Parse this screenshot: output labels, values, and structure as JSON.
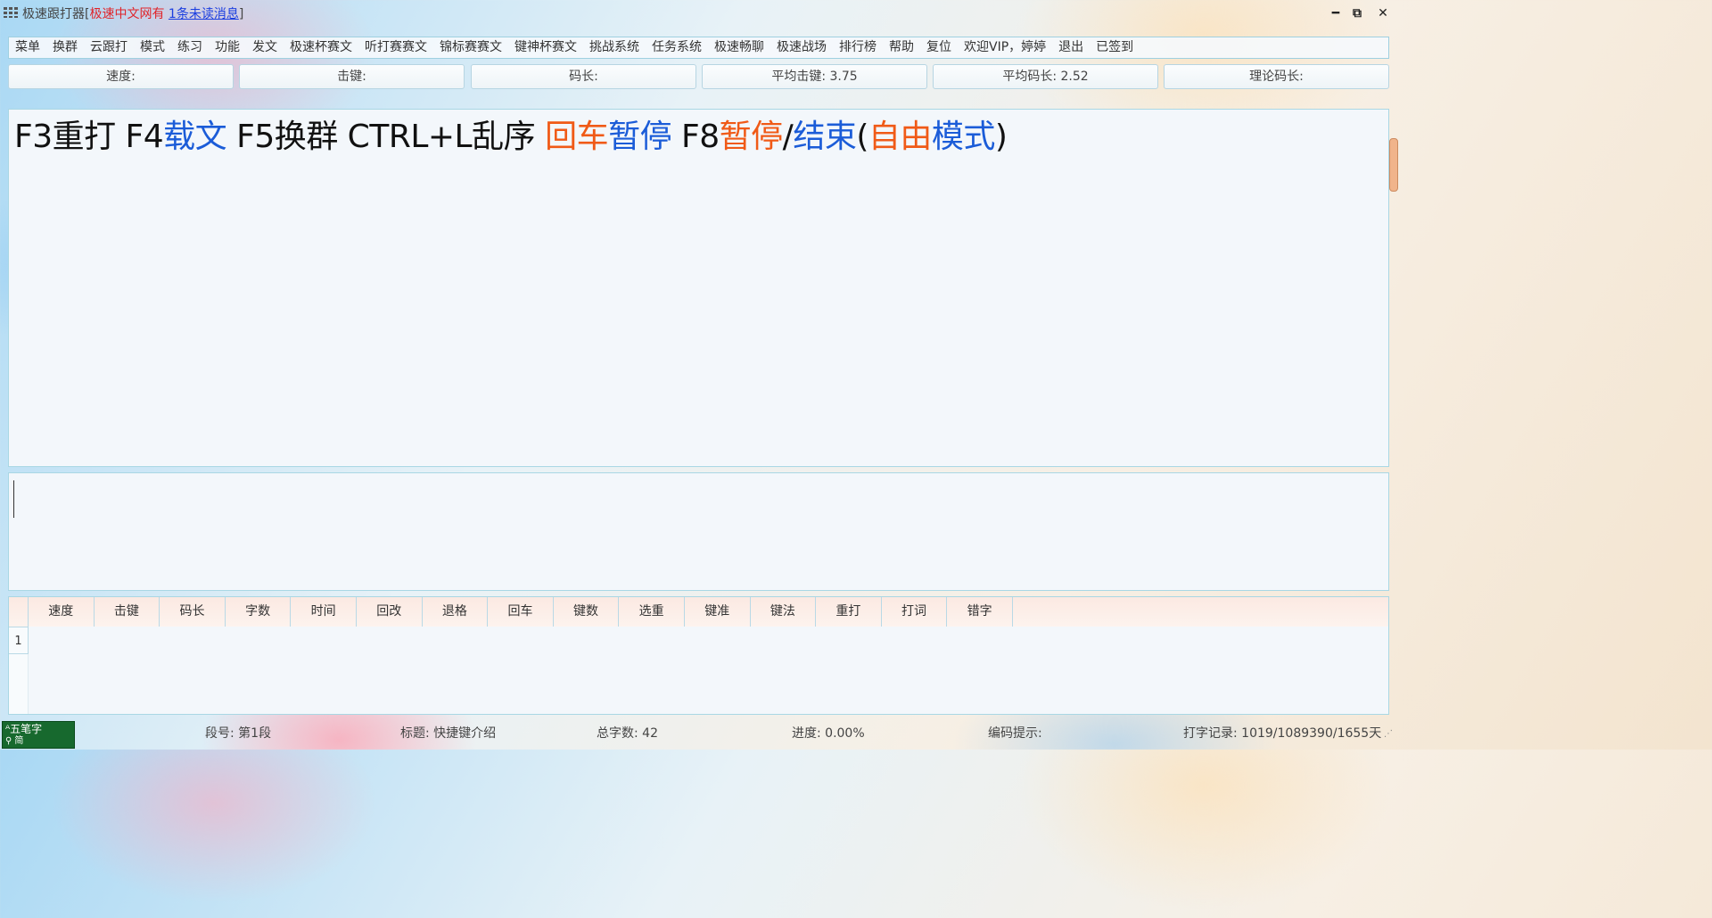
{
  "window": {
    "title_prefix": "极速跟打器[",
    "site_notice": "极速中文网有",
    "unread_link": "1条未读消息",
    "title_suffix": "]",
    "minimize": "━",
    "restore": "⧉",
    "close": "✕"
  },
  "menu": [
    "菜单",
    "换群",
    "云跟打",
    "模式",
    "练习",
    "功能",
    "发文",
    "极速杯赛文",
    "听打赛赛文",
    "锦标赛赛文",
    "键神杯赛文",
    "挑战系统",
    "任务系统",
    "极速畅聊",
    "极速战场",
    "排行榜",
    "帮助",
    "复位",
    "欢迎VIP，婷婷",
    "退出",
    "已签到"
  ],
  "stats": {
    "speed": "速度:",
    "keystroke": "击键:",
    "code_len": "码长:",
    "avg_keystroke": "平均击键: 3.75",
    "avg_code_len": "平均码长: 2.52",
    "theory_code_len": "理论码长:"
  },
  "source_text": {
    "s1": "F3重打 F4",
    "s2": "载文",
    "s3": " F5换群 CTRL+L乱序 ",
    "s4": "回车",
    "s5": "暂停",
    "s6": " F8",
    "s7": "暂停",
    "s8": "/",
    "s9": "结束",
    "s10": "(",
    "s11": "自由",
    "s12": "模式",
    "s13": ")"
  },
  "grid": {
    "headers": [
      "速度",
      "击键",
      "码长",
      "字数",
      "时间",
      "回改",
      "退格",
      "回车",
      "键数",
      "选重",
      "键准",
      "键法",
      "重打",
      "打词",
      "错字"
    ],
    "row_number": "1"
  },
  "status": {
    "segment": "段号: 第1段",
    "title": "标题: 快捷键介绍",
    "total_chars": "总字数: 42",
    "progress": "进度: 0.00%",
    "code_hint": "编码提示:",
    "record": "打字记录: 1019/1089390/1655天"
  },
  "ime": {
    "line1": "五笔字",
    "line2": "简"
  },
  "colors": {
    "blue": "#1b5cd8",
    "orange": "#f05a17",
    "title_red": "#e0242a",
    "link_blue": "#1a3ee0"
  }
}
